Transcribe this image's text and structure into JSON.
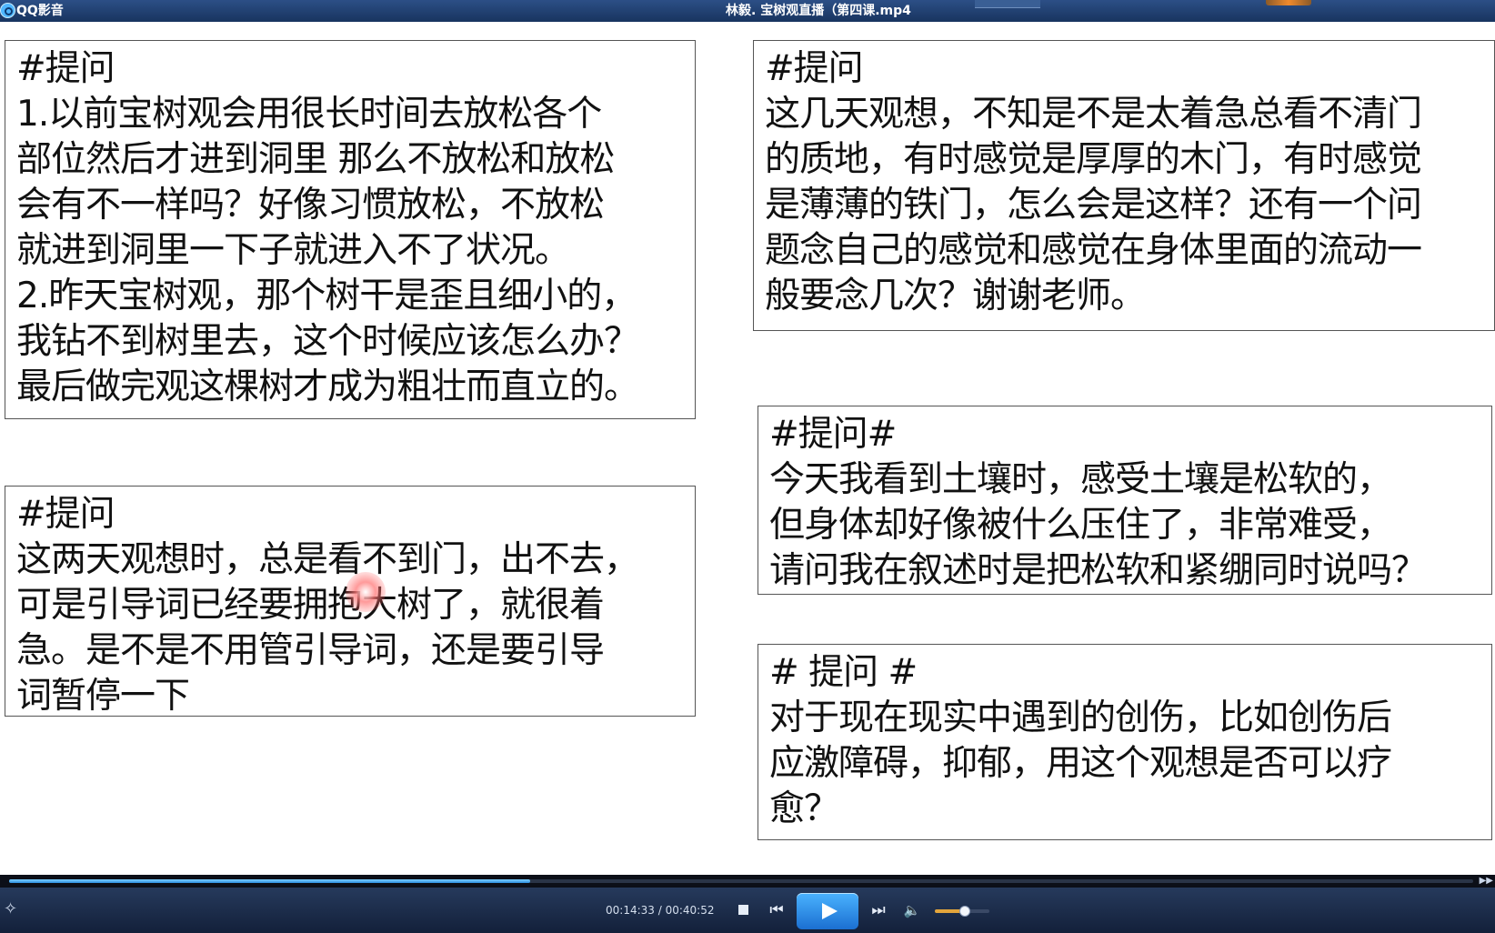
{
  "titlebar": {
    "app_name": "QQ影音",
    "title": "林毅. 宝树观直播（第四课.mp4"
  },
  "questions": [
    {
      "text": "#提问\n1.以前宝树观会用很长时间去放松各个\n部位然后才进到洞里 那么不放松和放松\n会有不一样吗？好像习惯放松，不放松\n就进到洞里一下子就进入不了状况。\n2.昨天宝树观，那个树干是歪且细小的，\n我钻不到树里去，这个时候应该怎么办？\n最后做完观这棵树才成为粗壮而直立的。"
    },
    {
      "text": "#提问\n这几天观想，不知是不是太着急总看不清门\n的质地，有时感觉是厚厚的木门，有时感觉\n是薄薄的铁门，怎么会是这样？还有一个问\n题念自己的感觉和感觉在身体里面的流动一\n般要念几次？谢谢老师。"
    },
    {
      "text": "#提问\n这两天观想时，总是看不到门，出不去，\n可是引导词已经要拥抱大树了，就很着\n急。是不是不用管引导词，还是要引导\n词暂停一下"
    },
    {
      "text": "#提问#\n今天我看到土壤时，感受土壤是松软的，\n但身体却好像被什么压住了，非常难受，\n请问我在叙述时是把松软和紧绷同时说吗？"
    },
    {
      "text": " # 提问 #\n对于现在现实中遇到的创伤，比如创伤后\n应激障碍，抑郁，用这个观想是否可以疗\n愈？"
    }
  ],
  "player": {
    "current_time": "00:14:33",
    "separator": " / ",
    "total_time": "00:40:52",
    "progress_fraction": 0.356,
    "volume_fraction": 0.55,
    "icons": {
      "stop": "stop-icon",
      "prev": "skip-previous-icon",
      "play": "play-icon",
      "next": "skip-next-icon",
      "volume": "volume-icon"
    },
    "accent_color": "#2c8fe0"
  }
}
